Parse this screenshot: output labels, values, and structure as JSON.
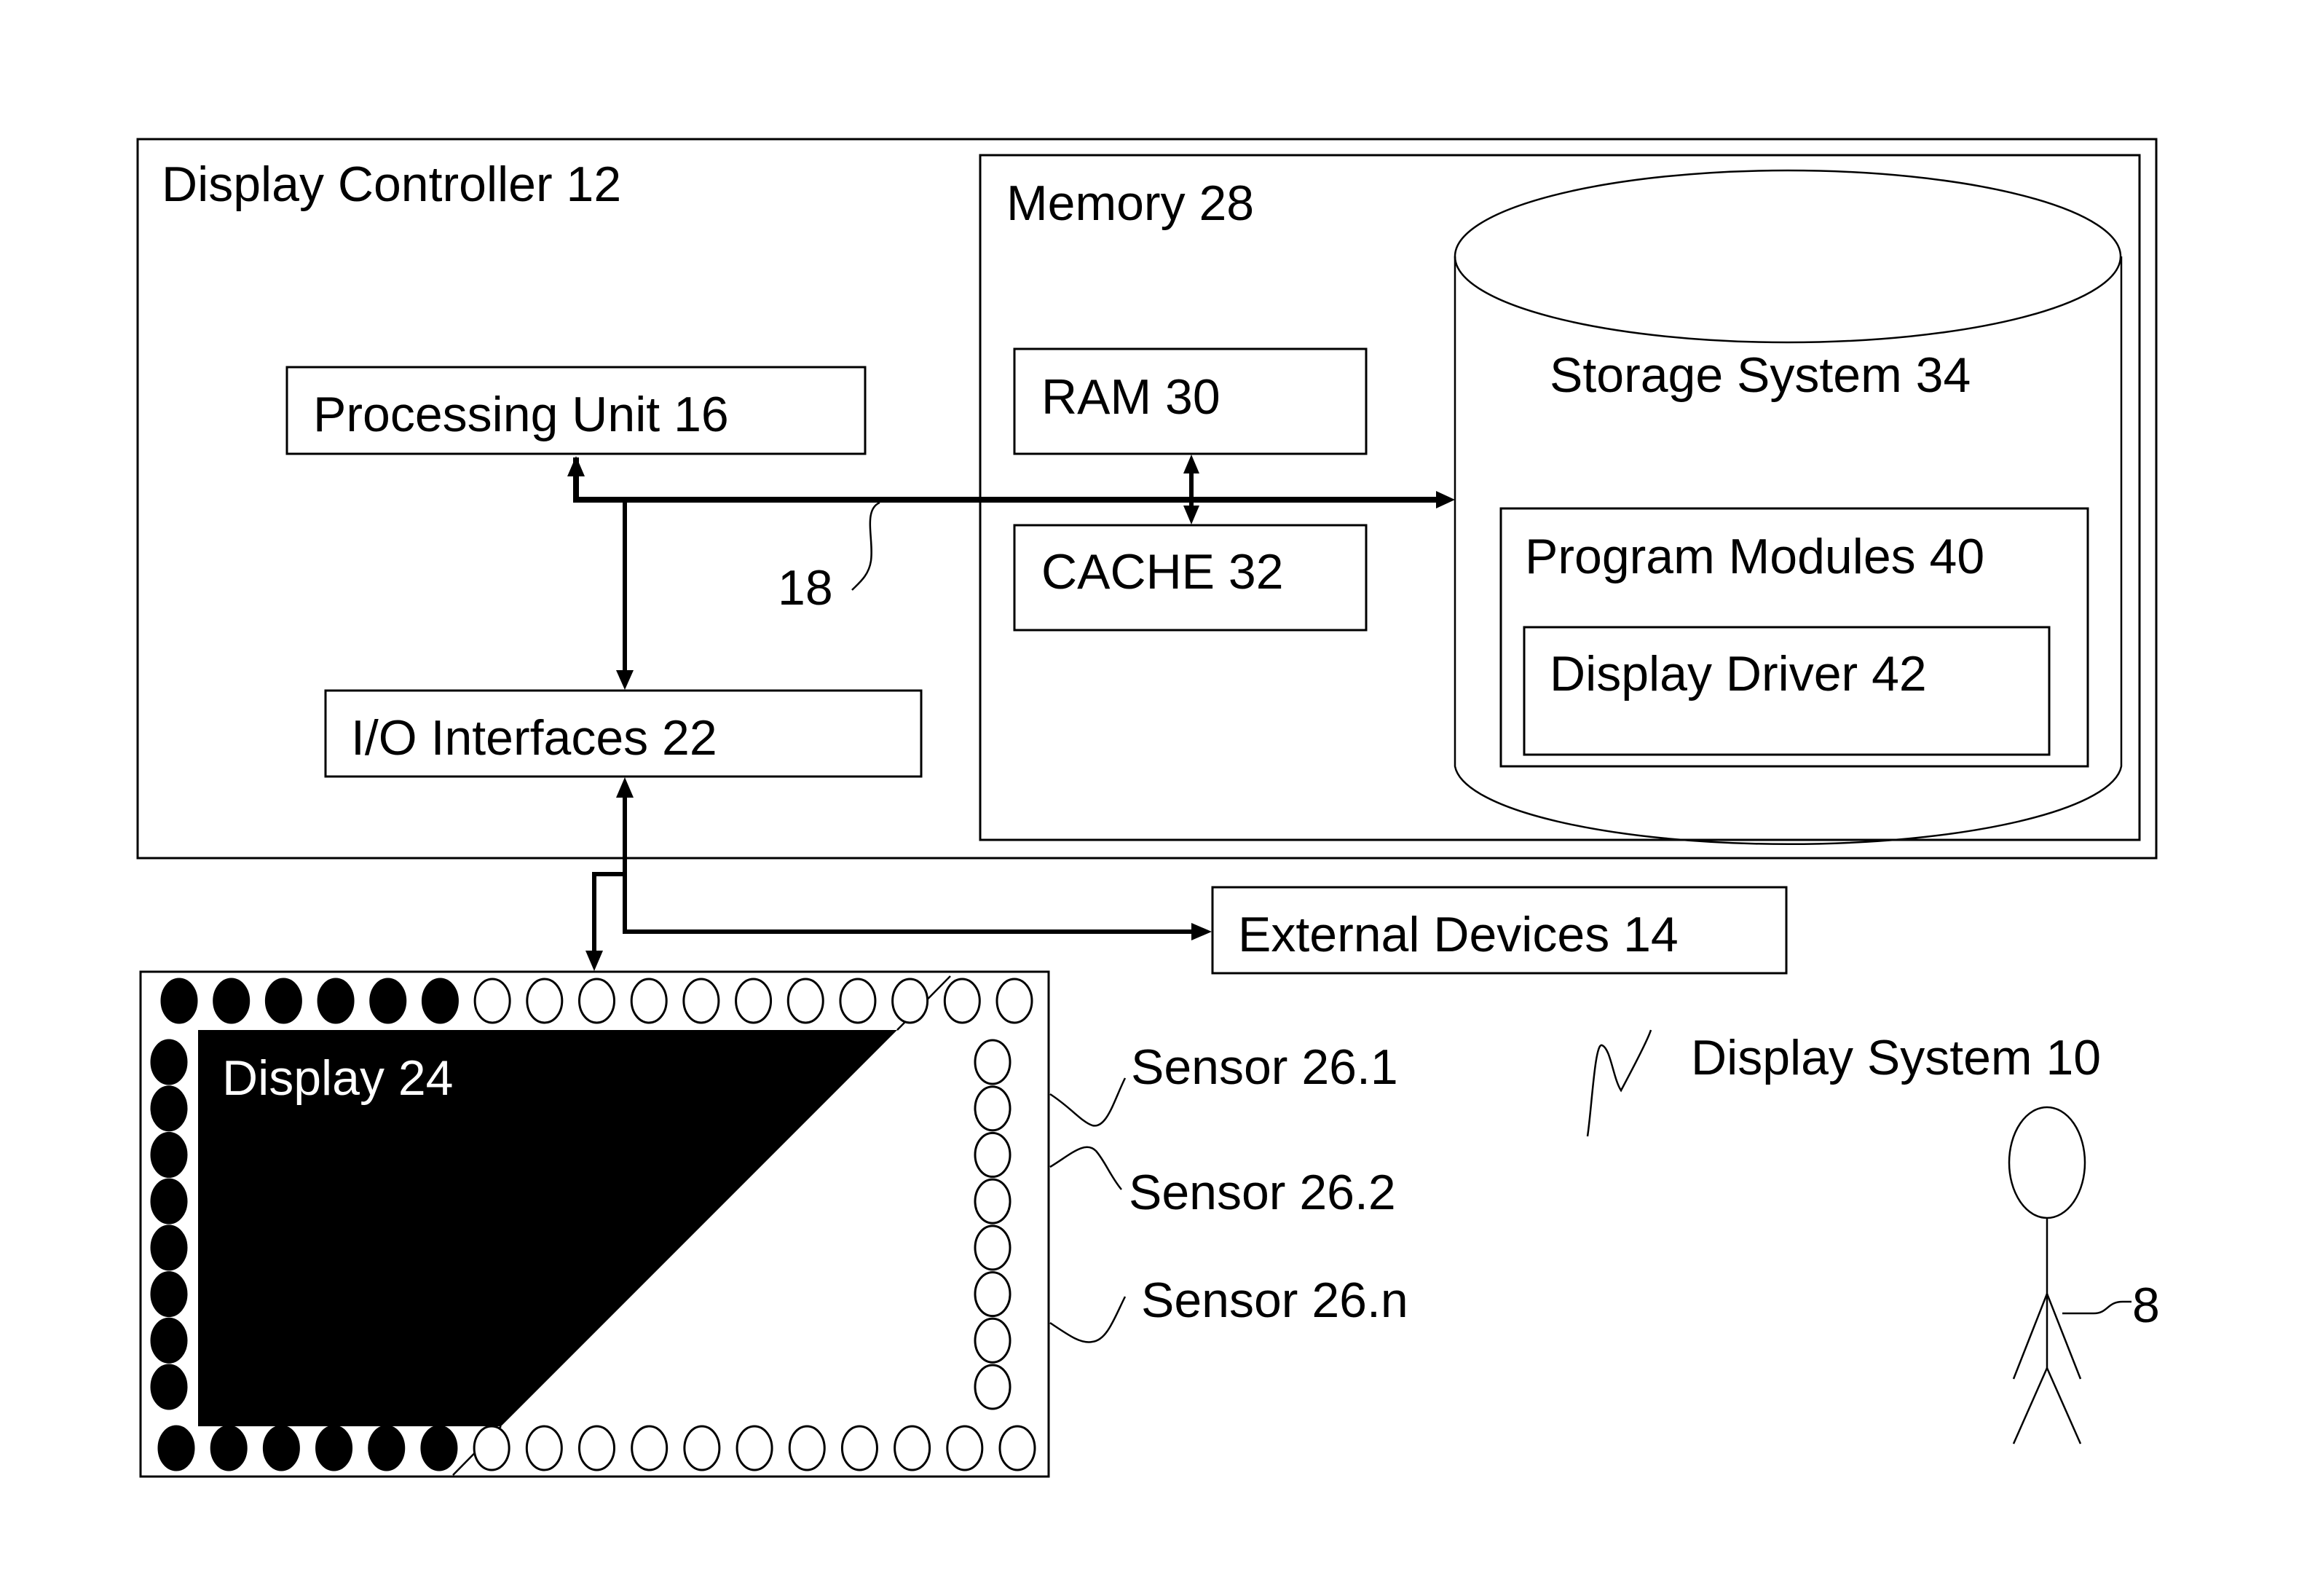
{
  "diagram": {
    "system_label": "Display System 10",
    "display_controller": {
      "label": "Display Controller 12"
    },
    "processing_unit": {
      "label": "Processing Unit 16"
    },
    "bus": {
      "label": "18"
    },
    "io_interfaces": {
      "label": "I/O Interfaces 22"
    },
    "memory": {
      "label": "Memory 28",
      "ram": {
        "label": "RAM 30"
      },
      "cache": {
        "label": "CACHE 32"
      },
      "storage": {
        "label": "Storage System 34",
        "program_modules": {
          "label": "Program Modules 40",
          "display_driver": {
            "label": "Display Driver 42"
          }
        }
      }
    },
    "external_devices": {
      "label": "External Devices 14"
    },
    "display": {
      "label": "Display 24",
      "sensors_top_filled": 6,
      "sensors_top_empty": 11,
      "sensors_left_filled": 8,
      "sensors_right_empty": 8,
      "sensors_bottom_filled": 6,
      "sensors_bottom_empty": 11
    },
    "sensors": [
      {
        "label": "Sensor 26.1"
      },
      {
        "label": "Sensor 26.2"
      },
      {
        "label": "Sensor 26.n"
      }
    ],
    "user": {
      "label": "8"
    }
  }
}
